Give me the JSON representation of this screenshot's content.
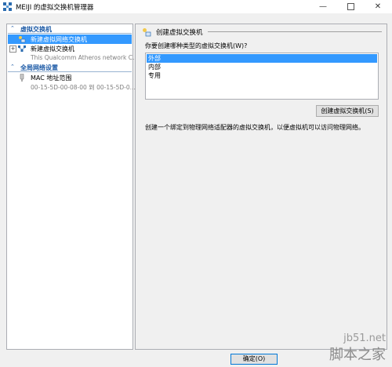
{
  "window": {
    "title": "MEIJI 的虚拟交换机管理器",
    "minimize_glyph": "—",
    "close_glyph": "✕"
  },
  "sidebar": {
    "virtual_switches_header": "虚拟交换机",
    "items": [
      {
        "label": "新建虚拟网络交换机",
        "icon": "new-switch-icon",
        "selected": true
      },
      {
        "label": "新建虚拟交换机",
        "icon": "network-switch-icon",
        "expander": "+",
        "sublabel": "This Qualcomm Atheros network C..."
      }
    ],
    "global_header": "全局网络设置",
    "global_items": [
      {
        "label": "MAC 地址范围",
        "icon": "mac-address-icon",
        "sublabel": "00-15-5D-00-08-00 到 00-15-5D-0..."
      }
    ],
    "collapse_glyph": "⌃"
  },
  "main": {
    "heading": "创建虚拟交换机",
    "question": "你要创建哪种类型的虚拟交换机(W)?",
    "switch_types": [
      "外部",
      "内部",
      "专用"
    ],
    "selected_type": "外部",
    "create_button": "创建虚拟交换机(S)",
    "description": "创建一个绑定到物理网络适配器的虚拟交换机，以便虚拟机可以访问物理网络。"
  },
  "footer": {
    "ok_button": "确定(O)"
  },
  "watermark": {
    "domain": "jb51.net",
    "name": "脚本之家"
  },
  "colors": {
    "accent": "#3399ff",
    "section_header": "#1c5aa6",
    "background": "#f0f0f0"
  }
}
